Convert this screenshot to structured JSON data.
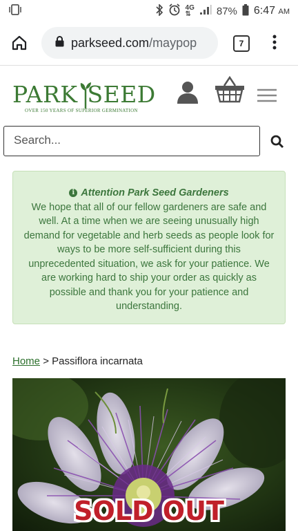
{
  "status_bar": {
    "battery": "87%",
    "network": "4G",
    "time": "6:47",
    "time_suffix": "AM"
  },
  "browser": {
    "url_host": "parkseed.com",
    "url_path": "/maypop",
    "tab_count": "7"
  },
  "site": {
    "logo_left": "PARK",
    "logo_right": "SEED",
    "logo_tagline": "OVER 150 YEARS OF SUPERIOR GERMINATION",
    "brand_color": "#3c7a34"
  },
  "search": {
    "placeholder": "Search..."
  },
  "notice": {
    "title": "Attention Park Seed Gardeners",
    "body": "We hope that all of our fellow gardeners are safe and well. At a time when we are seeing unusually high demand for vegetable and herb seeds as people look for ways to be more self-sufficient during this unprecedented situation, we ask for your patience. We are working hard to ship your order as quickly as possible and thank you for your patience and understanding."
  },
  "breadcrumb": {
    "home": "Home",
    "separator": ">",
    "current": "Passiflora incarnata"
  },
  "product": {
    "badge": "SOLD OUT"
  }
}
